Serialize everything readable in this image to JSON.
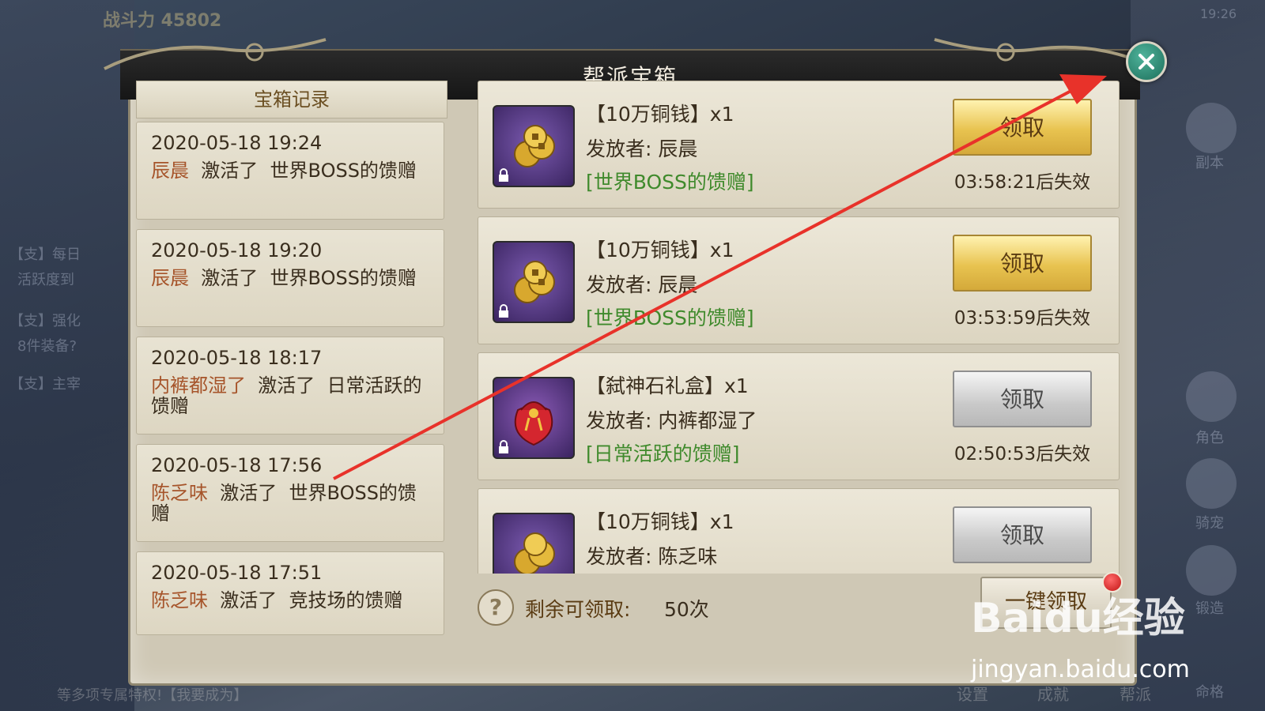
{
  "dialog": {
    "title": "帮派宝箱",
    "records_header": "宝箱记录",
    "records": [
      {
        "date": "2020-05-18  19:24",
        "who": "辰晨",
        "action": "激活了",
        "what": "世界BOSS的馈赠"
      },
      {
        "date": "2020-05-18  19:20",
        "who": "辰晨",
        "action": "激活了",
        "what": "世界BOSS的馈赠"
      },
      {
        "date": "2020-05-18  18:17",
        "who": "内裤都湿了",
        "action": "激活了",
        "what": "日常活跃的馈赠"
      },
      {
        "date": "2020-05-18  17:56",
        "who": "陈乏味",
        "action": "激活了",
        "what": "世界BOSS的馈赠"
      },
      {
        "date": "2020-05-18  17:51",
        "who": "陈乏味",
        "action": "激活了",
        "what": "竞技场的馈赠"
      }
    ],
    "rewards": [
      {
        "name": "【10万铜钱】x1",
        "giver_label": "发放者:",
        "giver": "辰晨",
        "source": "[世界BOSS的馈赠]",
        "button": "领取",
        "button_style": "gold",
        "expire": "03:58:21后失效",
        "icon": "coins-icon"
      },
      {
        "name": "【10万铜钱】x1",
        "giver_label": "发放者:",
        "giver": "辰晨",
        "source": "[世界BOSS的馈赠]",
        "button": "领取",
        "button_style": "gold",
        "expire": "03:53:59后失效",
        "icon": "coins-icon"
      },
      {
        "name": "【弑神石礼盒】x1",
        "giver_label": "发放者:",
        "giver": "内裤都湿了",
        "source": "[日常活跃的馈赠]",
        "button": "领取",
        "button_style": "gray",
        "expire": "02:50:53后失效",
        "icon": "gift-bag-icon"
      },
      {
        "name": "【10万铜钱】x1",
        "giver_label": "发放者:",
        "giver": "陈乏味",
        "source": "",
        "button": "领取",
        "button_style": "gray",
        "expire": "",
        "icon": "coins-icon"
      }
    ],
    "footer": {
      "remain_label": "剩余可领取:",
      "remain_value": "50次",
      "claim_all": "一键领取"
    }
  },
  "background": {
    "power": "战斗力 45802",
    "side_texts": [
      "【支】每日",
      "活跃度到",
      "【支】强化",
      "8件装备?",
      "【支】主宰"
    ],
    "right_labels": [
      "副本",
      "角色",
      "骑宠",
      "锻造",
      "命格"
    ],
    "bottom_labels": [
      "设置",
      "成就",
      "帮派"
    ],
    "bottom_banner": "等多项专属特权!【我要成为】",
    "time": "19:26"
  },
  "watermark": {
    "brand": "Baidu经验",
    "url": "jingyan.baidu.com"
  },
  "colors": {
    "annotation_arrow": "#e8322a",
    "giver_name": "#a6542a",
    "source_text": "#3f8a2c"
  }
}
